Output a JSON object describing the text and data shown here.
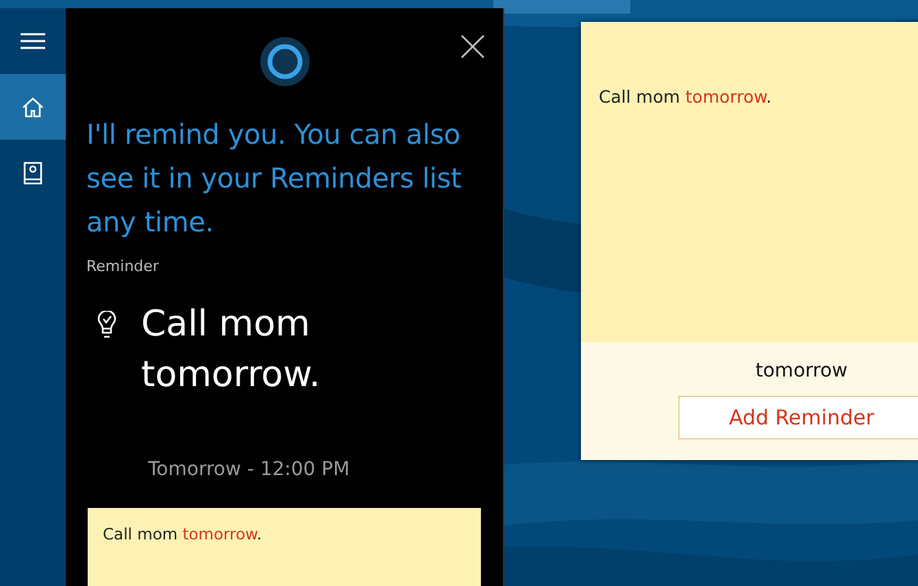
{
  "sidebar": {
    "items": [
      {
        "kind": "menu",
        "selected": false
      },
      {
        "kind": "home",
        "selected": true
      },
      {
        "kind": "notebook",
        "selected": false
      }
    ]
  },
  "cortana": {
    "message": "I'll remind you. You can also see it in your Reminders list any time.",
    "section_label": "Reminder",
    "reminder": {
      "title": "Call mom tomorrow.",
      "time": "Tomorrow - 12:00 PM"
    },
    "input": {
      "parts": [
        {
          "text": "Call mom ",
          "highlighted": false
        },
        {
          "text": "tomorrow",
          "highlighted": true
        },
        {
          "text": ".",
          "highlighted": false
        }
      ]
    }
  },
  "sticky_note": {
    "parts": [
      {
        "text": "Call mom ",
        "highlighted": false
      },
      {
        "text": "tomorrow",
        "highlighted": true
      },
      {
        "text": ".",
        "highlighted": false
      }
    ],
    "detected": "tomorrow",
    "button": "Add Reminder"
  }
}
